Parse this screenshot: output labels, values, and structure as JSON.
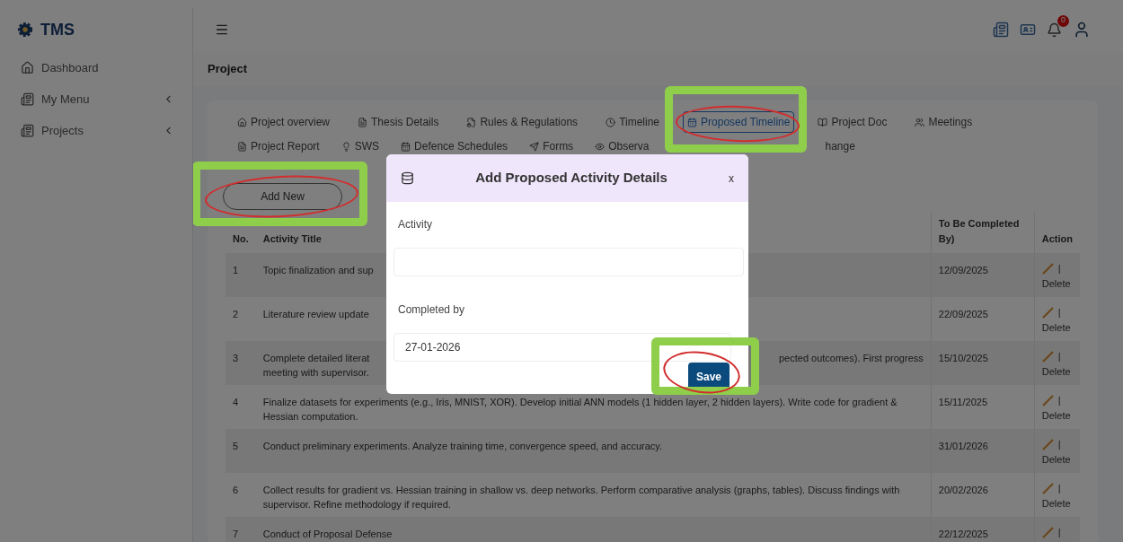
{
  "brand": {
    "name": "TMS"
  },
  "sidebar": {
    "items": [
      {
        "label": "Dashboard",
        "has_submenu": false
      },
      {
        "label": "My Menu",
        "has_submenu": true
      },
      {
        "label": "Projects",
        "has_submenu": true
      }
    ]
  },
  "topbar": {
    "notification_count": "0"
  },
  "page_title": "Project",
  "tab_rows": [
    [
      {
        "label": "Project overview",
        "selected": false
      },
      {
        "label": "Thesis Details",
        "selected": false
      },
      {
        "label": "Rules & Regulations",
        "selected": false
      },
      {
        "label": "Timeline",
        "selected": false
      },
      {
        "label": "Proposed Timeline",
        "selected": true
      },
      {
        "label": "Project Doc",
        "selected": false
      },
      {
        "label": "Meetings",
        "selected": false
      }
    ],
    [
      {
        "label": "Project Report",
        "selected": false
      },
      {
        "label": "SWS",
        "selected": false
      },
      {
        "label": "Defence Schedules",
        "selected": false
      },
      {
        "label": "Forms",
        "selected": false
      },
      {
        "label": "Observa",
        "selected": false
      },
      {
        "label": "hange",
        "selected": false
      }
    ]
  ],
  "add_button": "Add New",
  "table": {
    "columns": [
      "No.",
      "Activity Title",
      "To Be Completed By)",
      "Action"
    ],
    "rows": [
      {
        "no": "1",
        "title_lines": [
          [
            "Topic finalization and sup"
          ]
        ],
        "date": "12/09/2025",
        "separator": "|",
        "delete": "Delete"
      },
      {
        "no": "2",
        "title_lines": [
          [
            "Literature review update"
          ]
        ],
        "date": "22/09/2025",
        "separator": "|",
        "delete": "Delete"
      },
      {
        "no": "3",
        "title_lines": [
          [
            "Complete detailed literat",
            "pected outcomes). First progress"
          ],
          [
            "meeting with supervisor."
          ]
        ],
        "date": "15/10/2025",
        "separator": "|",
        "delete": "Delete"
      },
      {
        "no": "4",
        "title": "Finalize datasets for experiments (e.g., Iris, MNIST, XOR). Develop initial ANN models (1 hidden layer, 2 hidden layers). Write code for gradient & Hessian computation.",
        "date": "15/11/2025",
        "separator": "|",
        "delete": "Delete"
      },
      {
        "no": "5",
        "title": "Conduct preliminary experiments. Analyze training time, convergence speed, and accuracy.",
        "date": "31/01/2026",
        "separator": "|",
        "delete": "Delete"
      },
      {
        "no": "6",
        "title": "Collect results for gradient vs. Hessian training in shallow vs. deep networks. Perform comparative analysis (graphs, tables). Discuss findings with supervisor. Refine methodology if required.",
        "date": "20/02/2026",
        "separator": "|",
        "delete": "Delete"
      },
      {
        "no": "7",
        "title": "Conduct of Proposal Defense",
        "date": "22/12/2025",
        "separator": "|"
      }
    ]
  },
  "dialog": {
    "title": "Add Proposed Activity Details",
    "close": "x",
    "fields": [
      {
        "label": "Activity"
      },
      {
        "label": "Completed by",
        "value": "27-01-2026"
      }
    ],
    "save_button": "Save"
  }
}
